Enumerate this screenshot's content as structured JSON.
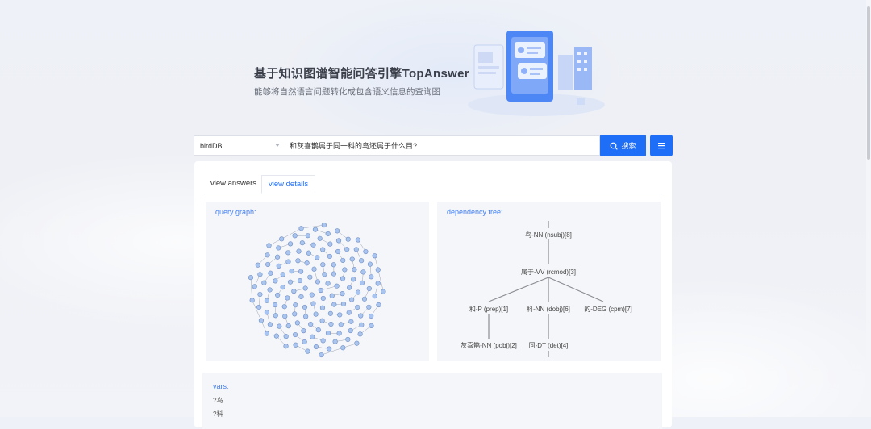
{
  "hero": {
    "title": "基于知识图谱智能问答引擎TopAnswer",
    "subtitle": "能够将自然语言问题转化成包含语义信息的查询图"
  },
  "search": {
    "database": "birdDB",
    "query": "和灰喜鹊属于同一科的鸟还属于什么目?",
    "button_label": "搜索",
    "accent": "#1e6ef7"
  },
  "tabs": [
    {
      "label": "view answers",
      "active": false
    },
    {
      "label": "view details",
      "active": true
    }
  ],
  "query_graph": {
    "label": "query graph:"
  },
  "dependency_tree": {
    "label": "dependency tree:",
    "nodes": [
      "鸟-NN (nsubj)[8]",
      "属于-VV (rcmod)[3]",
      "和-P (prep)[1]",
      "科-NN (dobj)[6]",
      "的-DEG (cpm)[7]",
      "灰喜鹊-NN (pobj)[2]",
      "同-DT (det)[4]"
    ]
  },
  "vars": {
    "label": "vars:",
    "items": [
      "?鸟",
      "?科"
    ]
  }
}
